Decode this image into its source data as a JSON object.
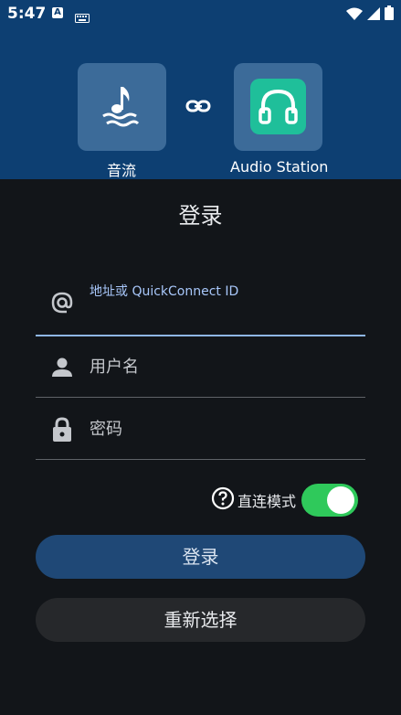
{
  "status_bar": {
    "time": "5:47",
    "indicator_letter": "A",
    "icons": [
      "keyboard-icon",
      "wifi-icon",
      "signal-icon",
      "battery-icon"
    ]
  },
  "header": {
    "apps": [
      {
        "label": "音流",
        "icon": "music-note-waves-icon"
      },
      {
        "label": "Audio Station",
        "icon": "headphones-icon"
      }
    ],
    "link_icon": "link-icon"
  },
  "login": {
    "title": "登录",
    "address": {
      "label": "地址或 QuickConnect ID",
      "value": "",
      "icon": "at-icon"
    },
    "username": {
      "placeholder": "用户名",
      "icon": "person-icon"
    },
    "password": {
      "placeholder": "密码",
      "icon": "lock-icon"
    },
    "direct_mode": {
      "label": "直连模式",
      "enabled": true,
      "icon": "help-circle-icon"
    },
    "login_button": "登录",
    "reselect_button": "重新选择"
  },
  "colors": {
    "header_bg": "#0d3f72",
    "page_bg": "#121519",
    "accent": "#8fb7e6",
    "primary_button": "#1f4876",
    "toggle_on": "#2fc95b",
    "audio_station_teal": "#1fbf9a"
  }
}
